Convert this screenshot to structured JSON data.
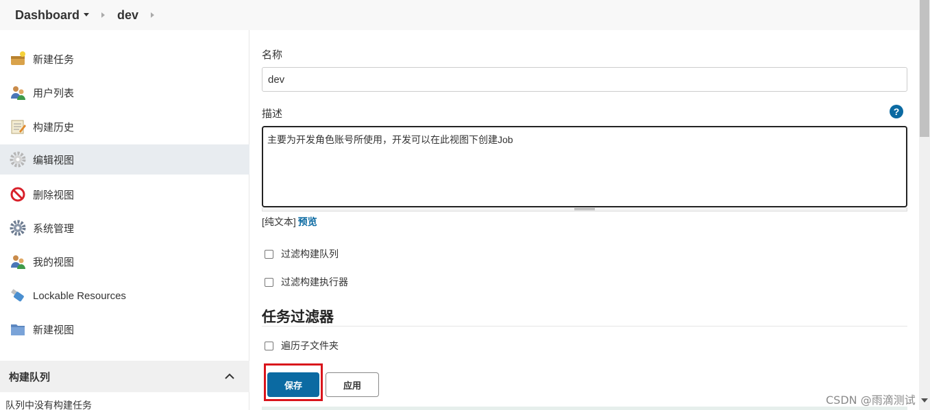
{
  "breadcrumb": {
    "items": [
      "Dashboard",
      "dev"
    ]
  },
  "sidebar": {
    "items": [
      {
        "label": "新建任务",
        "icon": "new-task-icon"
      },
      {
        "label": "用户列表",
        "icon": "users-icon"
      },
      {
        "label": "构建历史",
        "icon": "build-history-icon"
      },
      {
        "label": "编辑视图",
        "icon": "gear-icon",
        "active": true
      },
      {
        "label": "删除视图",
        "icon": "no-entry-icon"
      },
      {
        "label": "系统管理",
        "icon": "gear-icon"
      },
      {
        "label": "我的视图",
        "icon": "users-icon"
      },
      {
        "label": "Lockable Resources",
        "icon": "usb-icon"
      },
      {
        "label": "新建视图",
        "icon": "folder-icon"
      }
    ],
    "queue": {
      "title": "构建队列",
      "empty_text": "队列中没有构建任务"
    }
  },
  "form": {
    "name_label": "名称",
    "name_value": "dev",
    "description_label": "描述",
    "description_value": "主要为开发角色账号所使用，开发可以在此视图下创建Job",
    "format_prefix": "[纯文本]",
    "preview_link": "预览",
    "filter_queue_label": "过滤构建队列",
    "filter_executor_label": "过滤构建执行器",
    "job_filter_title": "任务过滤器",
    "recurse_label": "遍历子文件夹",
    "save_button": "保存",
    "apply_button": "应用"
  },
  "watermark": "CSDN @雨滴测试",
  "colors": {
    "accent": "#0b6aa2",
    "highlight": "#d9141b"
  }
}
